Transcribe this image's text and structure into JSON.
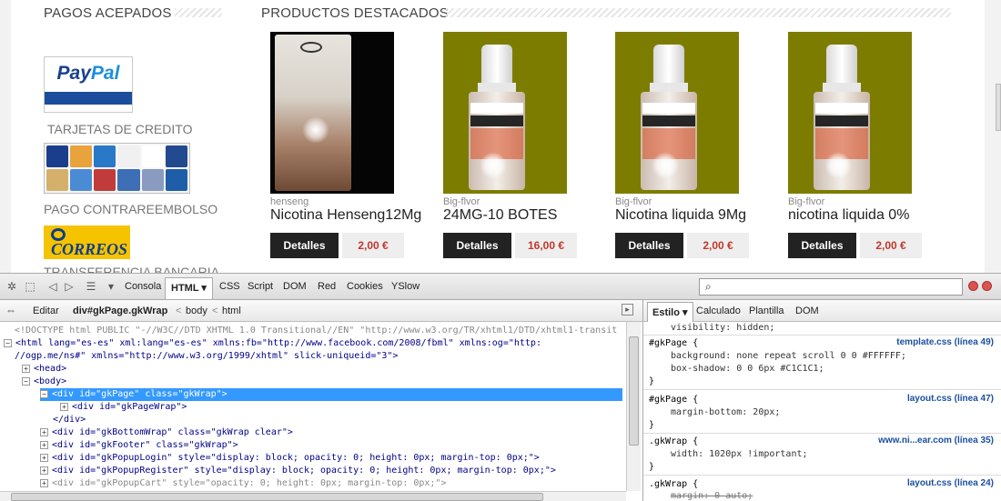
{
  "site": {
    "left_title": "PAGOS ACEPADOS",
    "right_title": "PRODUCTOS DESTACADOS",
    "paypal_logo": "PayPal",
    "card_label": "TARJETAS DE CREDITO",
    "cod_label": "PAGO CONTRAREEMBOLSO",
    "correos_logo": "CORREOS",
    "transfer_label": "TRANSFERENCIA BANCARIA",
    "products": [
      {
        "brand": "henseng",
        "name": "Nicotina Henseng12Mg",
        "button": "Detalles",
        "price": "2,00 €"
      },
      {
        "brand": "Big-flvor",
        "name": "24MG-10 BOTES",
        "button": "Detalles",
        "price": "16,00 €"
      },
      {
        "brand": "Big-flvor",
        "name": "Nicotina liquida 9Mg",
        "button": "Detalles",
        "price": "2,00 €"
      },
      {
        "brand": "Big-flvor",
        "name": "nicotina liquida 0%",
        "button": "Detalles",
        "price": "2,00 €"
      }
    ],
    "card_colors": [
      "#1a3e8c",
      "#e8a33d",
      "#2a79c8",
      "#f0f0f0",
      "#ffffff",
      "#224a8f",
      "#d4b06a",
      "#4b8bd4",
      "#c23b3b",
      "#3c6fb5",
      "#8a9bc1",
      "#1e5ea8"
    ]
  },
  "firebug": {
    "tabs": [
      "Consola",
      "HTML",
      "CSS",
      "Script",
      "DOM",
      "Red",
      "Cookies",
      "YSlow"
    ],
    "active_tab": "HTML",
    "edit_label": "Editar",
    "breadcrumb": [
      "div#gkPage.gkWrap",
      "body",
      "html"
    ],
    "side_tabs": [
      "Estilo",
      "Calculado",
      "Plantilla",
      "DOM"
    ],
    "active_side_tab": "Estilo",
    "html_lines": {
      "doctype": "<!DOCTYPE html PUBLIC \"-//W3C//DTD XHTML 1.0 Transitional//EN\" \"http://www.w3.org/TR/xhtml1/DTD/xhtml1-transit",
      "html_open": "<html lang=\"es-es\" xml:lang=\"es-es\" xmlns:fb=\"http://www.facebook.com/2008/fbml\" xmlns:og=\"http:",
      "html_cont": "//ogp.me/ns#\" xmlns=\"http://www.w3.org/1999/xhtml\" slick-uniqueid=\"3\">",
      "head": "<head>",
      "body": "<body>",
      "gkpage": "<div id=\"gkPage\" class=\"gkWrap\">",
      "gkpagewrap": "<div id=\"gkPageWrap\">",
      "div_close": "</div>",
      "gkbottomwrap": "<div id=\"gkBottomWrap\" class=\"gkWrap clear\">",
      "gkfooter": "<div id=\"gkFooter\" class=\"gkWrap\">",
      "popuplogin": "<div id=\"gkPopupLogin\" style=\"display: block; opacity: 0; height: 0px; margin-top: 0px;\">",
      "popupregister": "<div id=\"gkPopupRegister\" style=\"display: block; opacity: 0; height: 0px; margin-top: 0px;\">",
      "popupcart": "<div id=\"gkPopupCart\" style=\"opacity: 0; height: 0px; margin-top: 0px;\">"
    },
    "style_lines": {
      "l0": "visibility: hidden;",
      "r1_sel": "#gkPage {",
      "r1_src": "template.css (línea 49)",
      "r1_p1": "background: none repeat scroll 0 0 #FFFFFF;",
      "r1_p2": "box-shadow: 0 0 6px #C1C1C1;",
      "close": "}",
      "r2_sel": "#gkPage {",
      "r2_src": "layout.css (línea 47)",
      "r2_p1": "margin-bottom: 20px;",
      "r3_sel": ".gkWrap {",
      "r3_src": "www.ni...ear.com (línea 35)",
      "r3_p1": "width: 1020px !important;",
      "r4_sel": ".gkWrap {",
      "r4_src": "layout.css (línea 24)",
      "r4_p1": "margin: 0 auto;"
    }
  }
}
